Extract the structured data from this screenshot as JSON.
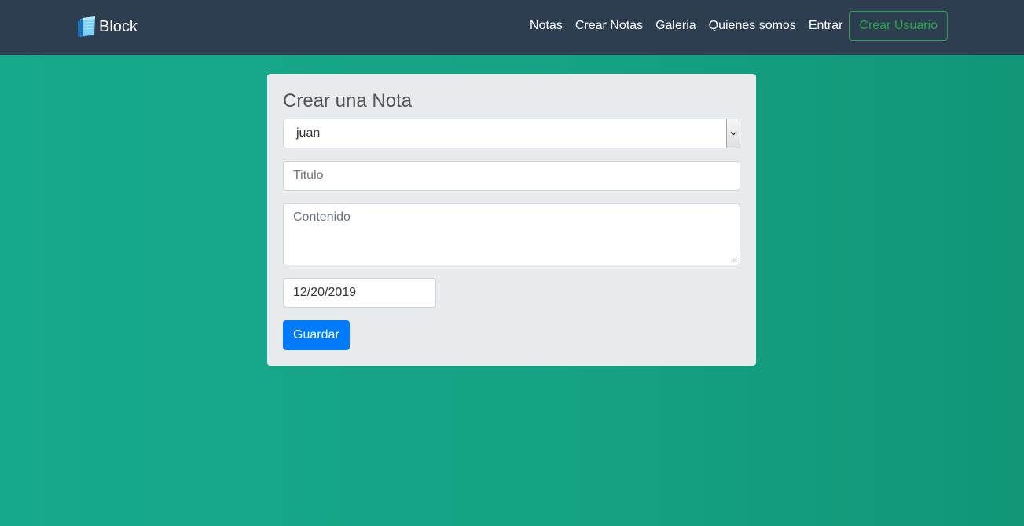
{
  "navbar": {
    "brand": {
      "icon": "notebook-icon",
      "text": "Block"
    },
    "links": [
      {
        "label": "Notas"
      },
      {
        "label": "Crear Notas"
      },
      {
        "label": "Galeria"
      },
      {
        "label": "Quienes somos"
      },
      {
        "label": "Entrar"
      }
    ],
    "create_user_label": "Crear Usuario"
  },
  "form": {
    "title": "Crear una Nota",
    "user_select": {
      "selected": "juan",
      "icon": "chevron-down-icon"
    },
    "title_input": {
      "value": "",
      "placeholder": "Titulo"
    },
    "content_input": {
      "value": "",
      "placeholder": "Contenido"
    },
    "date_input": {
      "value": "12/20/2019"
    },
    "submit_label": "Guardar"
  },
  "colors": {
    "navbar_bg": "#2c3e50",
    "page_bg": "#16a085",
    "card_bg": "#e8ebee",
    "primary": "#007bff",
    "success": "#28a745"
  }
}
